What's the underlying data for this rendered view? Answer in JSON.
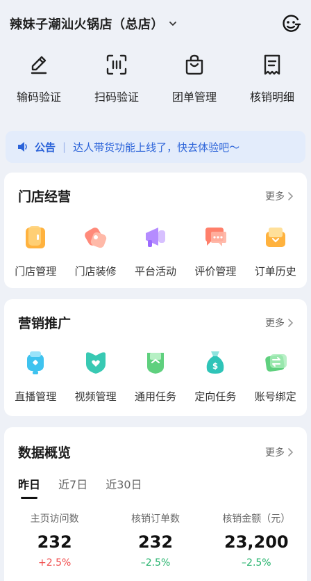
{
  "header": {
    "store_name": "辣妹子潮汕火锅店（总店）"
  },
  "quick_actions": [
    {
      "label": "输码验证",
      "icon": "pencil-edit-icon"
    },
    {
      "label": "扫码验证",
      "icon": "scan-icon"
    },
    {
      "label": "团单管理",
      "icon": "bag-icon"
    },
    {
      "label": "核销明细",
      "icon": "receipt-icon"
    }
  ],
  "notice": {
    "tag": "公告",
    "text": "达人带货功能上线了，快去体验吧～"
  },
  "store_ops": {
    "title": "门店经营",
    "more": "更多",
    "items": [
      {
        "label": "门店管理",
        "icon": "store-manage-icon"
      },
      {
        "label": "门店装修",
        "icon": "store-decorate-icon"
      },
      {
        "label": "平台活动",
        "icon": "megaphone-icon"
      },
      {
        "label": "评价管理",
        "icon": "chat-bubble-icon"
      },
      {
        "label": "订单历史",
        "icon": "order-history-icon"
      }
    ]
  },
  "marketing": {
    "title": "营销推广",
    "more": "更多",
    "items": [
      {
        "label": "直播管理",
        "icon": "live-icon"
      },
      {
        "label": "视频管理",
        "icon": "video-heart-icon"
      },
      {
        "label": "通用任务",
        "icon": "task-icon"
      },
      {
        "label": "定向任务",
        "icon": "money-bag-icon"
      },
      {
        "label": "账号绑定",
        "icon": "account-bind-icon"
      }
    ]
  },
  "data_overview": {
    "title": "数据概览",
    "more": "更多",
    "tabs": [
      "昨日",
      "近7日",
      "近30日"
    ],
    "stats": [
      {
        "label": "主页访问数",
        "value": "232",
        "delta": "+2.5%"
      },
      {
        "label": "核销订单数",
        "value": "232",
        "delta": "–2.5%"
      },
      {
        "label": "核销金额（元）",
        "value": "23,200",
        "delta": "–2.5%"
      }
    ]
  },
  "colors": {
    "accent": "#2b63d9",
    "up": "#f04a4a",
    "down": "#23b26b"
  }
}
